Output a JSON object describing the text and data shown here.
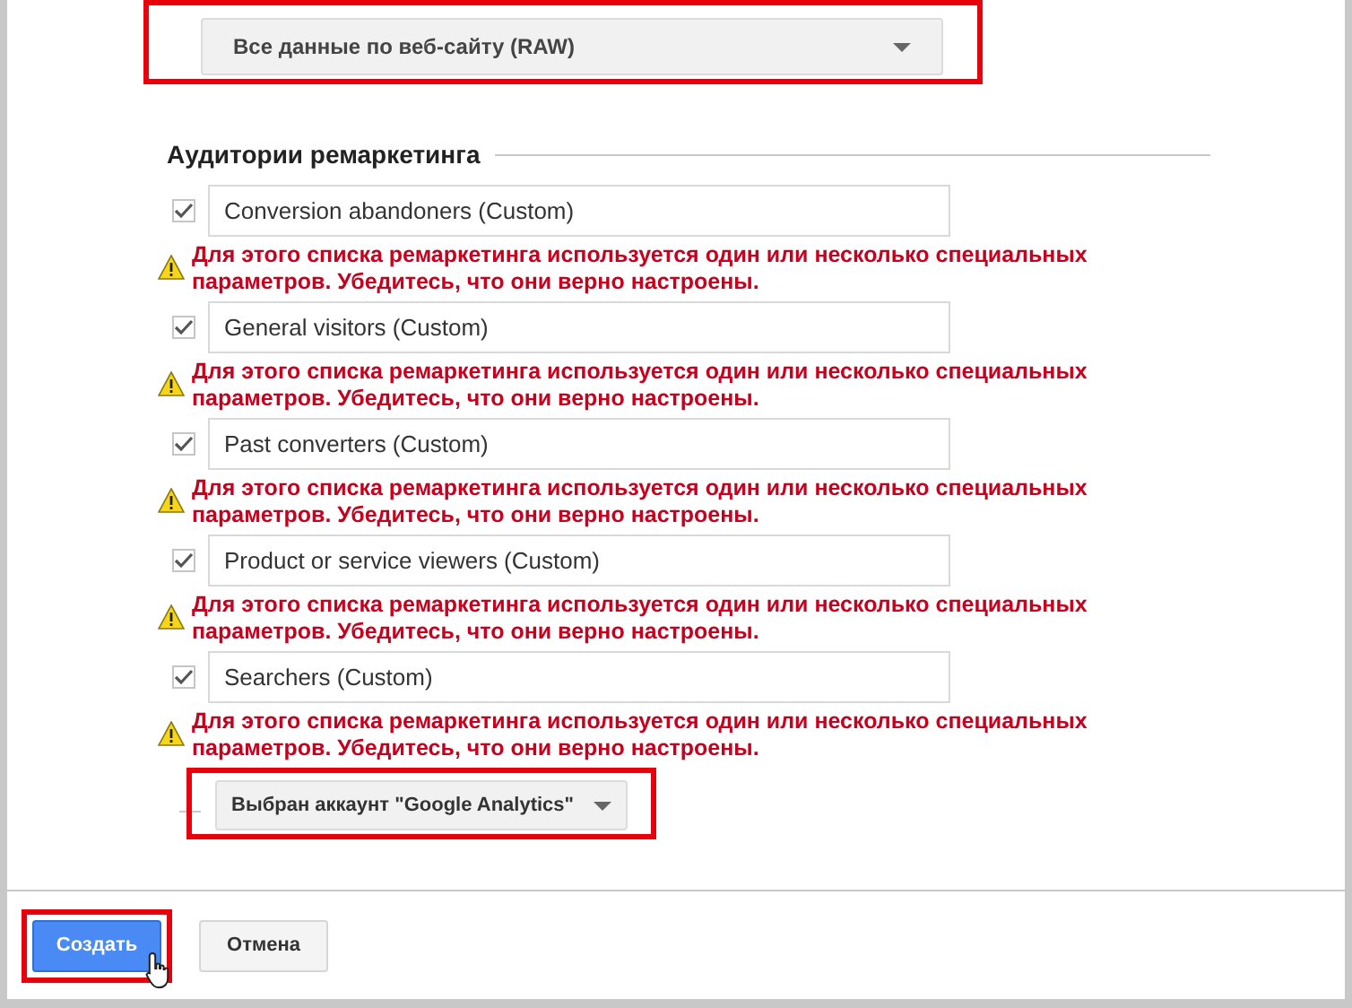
{
  "view_dropdown": {
    "value": "Все данные по веб-сайту (RAW)",
    "highlighted": true
  },
  "remarketing": {
    "title": "Аудитории ремаркетинга",
    "audiences": [
      {
        "name": "Conversion abandoners (Custom)",
        "checked": true,
        "warning": "Для этого списка ремаркетинга используется один или несколько специальных параметров. Убедитесь, что они верно настроены."
      },
      {
        "name": "General visitors (Custom)",
        "checked": true,
        "warning": "Для этого списка ремаркетинга используется один или несколько специальных параметров. Убедитесь, что они верно настроены."
      },
      {
        "name": "Past converters (Custom)",
        "checked": true,
        "warning": "Для этого списка ремаркетинга используется один или несколько специальных параметров. Убедитесь, что они верно настроены."
      },
      {
        "name": "Product or service viewers (Custom)",
        "checked": true,
        "warning": "Для этого списка ремаркетинга используется один или несколько специальных параметров. Убедитесь, что они верно настроены."
      },
      {
        "name": "Searchers (Custom)",
        "checked": true,
        "warning": "Для этого списка ремаркетинга используется один или несколько специальных параметров. Убедитесь, что они верно настроены."
      }
    ]
  },
  "account_dropdown": {
    "value": "Выбран аккаунт \"Google Analytics\"",
    "highlighted": true
  },
  "buttons": [
    {
      "label": "Создать",
      "kind": "primary",
      "highlighted": true
    },
    {
      "label": "Отмена",
      "kind": "secondary",
      "highlighted": false
    }
  ]
}
